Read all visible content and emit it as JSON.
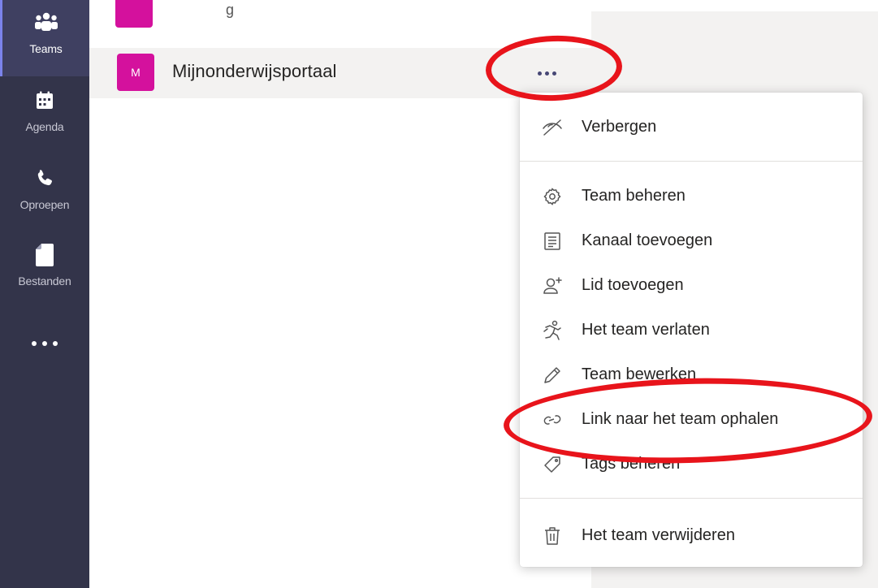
{
  "rail": {
    "items": [
      {
        "label": "Teams",
        "icon": "teams-icon",
        "active": true
      },
      {
        "label": "Agenda",
        "icon": "calendar-icon"
      },
      {
        "label": "Oproepen",
        "icon": "phone-icon"
      },
      {
        "label": "Bestanden",
        "icon": "file-icon"
      }
    ],
    "more_icon": "more-apps-icon"
  },
  "teams": {
    "partial_label": "g",
    "current": {
      "avatar_letter": "M",
      "name": "Mijnonderwijsportaal",
      "avatar_color": "#d4119d"
    }
  },
  "menu": {
    "items": [
      {
        "label": "Verbergen",
        "icon": "hide-icon"
      },
      {
        "label": "Team beheren",
        "icon": "gear-icon"
      },
      {
        "label": "Kanaal toevoegen",
        "icon": "channel-icon"
      },
      {
        "label": "Lid toevoegen",
        "icon": "add-member-icon"
      },
      {
        "label": "Het team verlaten",
        "icon": "leave-icon"
      },
      {
        "label": "Team bewerken",
        "icon": "pencil-icon"
      },
      {
        "label": "Link naar het team ophalen",
        "icon": "link-icon"
      },
      {
        "label": "Tags beheren",
        "icon": "tag-icon"
      },
      {
        "label": "Het team verwijderen",
        "icon": "trash-icon"
      }
    ]
  },
  "colors": {
    "rail": "#33344a",
    "accent": "#464775",
    "annotation": "#e8141b"
  }
}
